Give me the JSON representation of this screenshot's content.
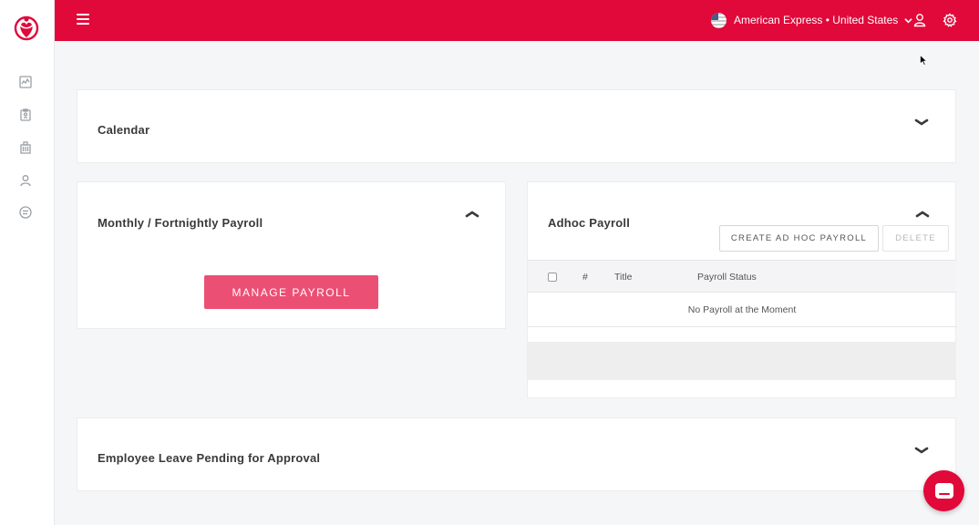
{
  "app": {
    "brand_color": "#e1083a",
    "logo": "heart-person-logo"
  },
  "sidebar": {
    "items": [
      {
        "icon": "activity-chart-icon"
      },
      {
        "icon": "clipboard-icon"
      },
      {
        "icon": "building-icon"
      },
      {
        "icon": "user-icon"
      },
      {
        "icon": "chat-list-icon"
      }
    ]
  },
  "topbar": {
    "menu_icon": "hamburger-icon",
    "company_selector": "American Express • United States",
    "flag_icon": "us-flag-icon",
    "profile_icon": "user-icon",
    "settings_icon": "gear-icon"
  },
  "calendar": {
    "title": "Calendar",
    "toggle_icon": "chevron-down-icon"
  },
  "monthly_payroll": {
    "title": "Monthly / Fortnightly Payroll",
    "toggle_icon": "chevron-up-icon",
    "manage_button": "MANAGE PAYROLL",
    "button_color": "#ec4f74"
  },
  "adhoc_payroll": {
    "title": "Adhoc Payroll",
    "toggle_icon": "chevron-up-icon",
    "create_button": "CREATE AD HOC PAYROLL",
    "delete_button": "DELETE",
    "table": {
      "columns": [
        "#",
        "Title",
        "Payroll Status"
      ],
      "empty_message": "No Payroll at the Moment"
    }
  },
  "leave_approval": {
    "title": "Employee Leave Pending for Approval",
    "toggle_icon": "chevron-down-icon"
  },
  "chat": {
    "icon": "chat-bubble-icon"
  }
}
